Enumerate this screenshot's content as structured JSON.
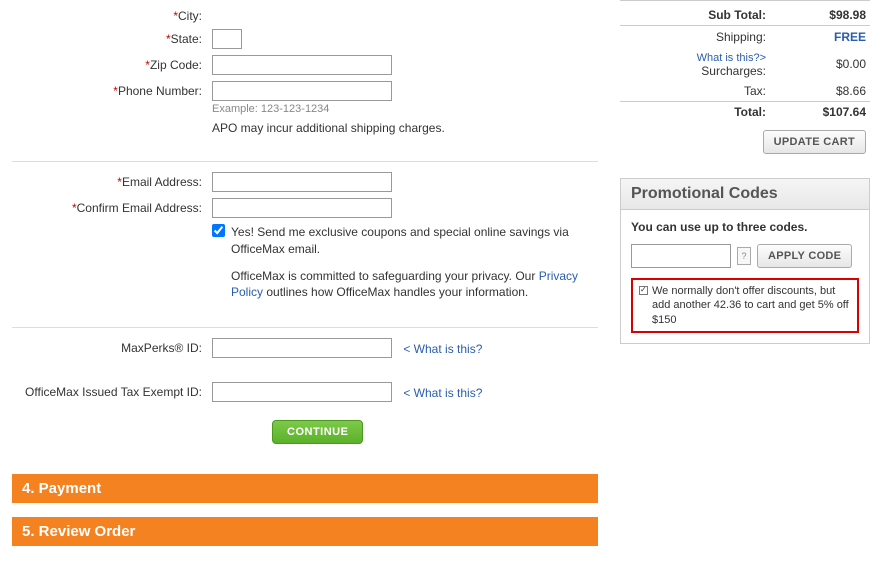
{
  "form": {
    "city_label": "City:",
    "state_label": "State:",
    "zip_label": "Zip Code:",
    "phone_label": "Phone Number:",
    "phone_hint": "Example: 123-123-1234",
    "apo_note": "APO may incur additional shipping charges.",
    "email_label": "Email Address:",
    "confirm_email_label": "Confirm Email Address:",
    "optin_text": "Yes! Send me exclusive coupons and special online savings via OfficeMax email.",
    "privacy_pre": "OfficeMax is committed to safeguarding your privacy. Our ",
    "privacy_link": "Privacy Policy",
    "privacy_post": " outlines how OfficeMax handles your information.",
    "maxperks_label": "MaxPerks® ID:",
    "taxexempt_label": "OfficeMax Issued Tax Exempt ID:",
    "what_is_this": "< What is this?",
    "continue": "CONTINUE"
  },
  "steps": {
    "payment": "4. Payment",
    "review": "5. Review Order"
  },
  "totals": {
    "subtotal_label": "Sub Total:",
    "subtotal_value": "$98.98",
    "shipping_label": "Shipping:",
    "shipping_value": "FREE",
    "surcharges_label": "Surcharges:",
    "surcharges_link": "What is this?>",
    "surcharges_value": "$0.00",
    "tax_label": "Tax:",
    "tax_value": "$8.66",
    "total_label": "Total:",
    "total_value": "$107.64",
    "update_btn": "UPDATE CART"
  },
  "promo": {
    "heading": "Promotional Codes",
    "subheading": "You can use up to three codes.",
    "apply_btn": "APPLY CODE",
    "note": "We normally don't offer discounts, but add another 42.36 to cart and get 5% off $150"
  }
}
